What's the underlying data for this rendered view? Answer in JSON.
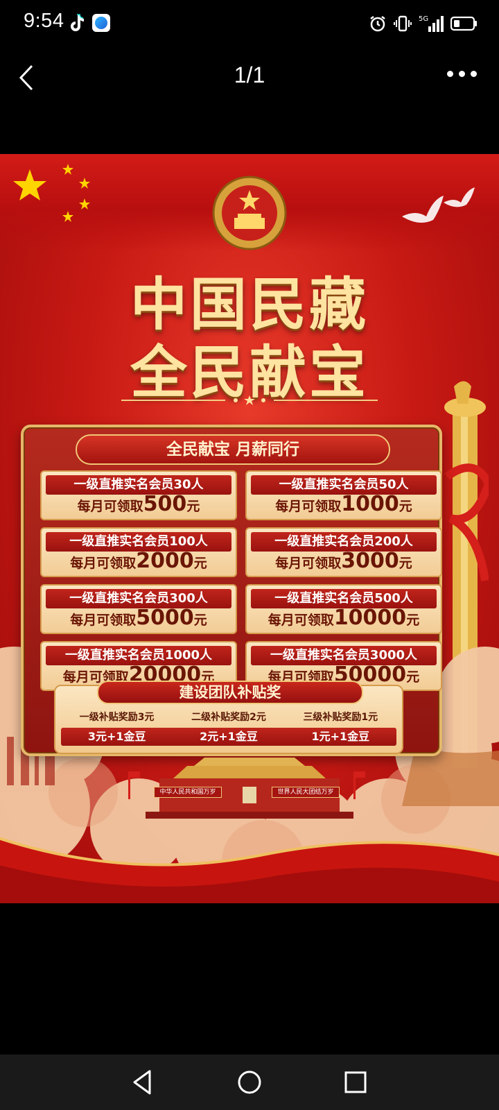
{
  "status_bar": {
    "time": "9:54",
    "icons": [
      "tiktok-icon",
      "browser-app-icon",
      "alarm-icon",
      "vibrate-icon",
      "5g-signal-icon",
      "battery-icon"
    ],
    "network": "5G"
  },
  "viewer": {
    "page_indicator": "1/1"
  },
  "poster": {
    "title_line1": "中国民藏",
    "title_line2": "全民献宝",
    "panel_header": "全民献宝  月薪同行",
    "tiers": [
      {
        "requirement": "一级直推实名会员30人",
        "prefix": "每月可领取",
        "amount": "500",
        "unit": "元"
      },
      {
        "requirement": "一级直推实名会员50人",
        "prefix": "每月可领取",
        "amount": "1000",
        "unit": "元"
      },
      {
        "requirement": "一级直推实名会员100人",
        "prefix": "每月可领取",
        "amount": "2000",
        "unit": "元"
      },
      {
        "requirement": "一级直推实名会员200人",
        "prefix": "每月可领取",
        "amount": "3000",
        "unit": "元"
      },
      {
        "requirement": "一级直推实名会员300人",
        "prefix": "每月可领取",
        "amount": "5000",
        "unit": "元"
      },
      {
        "requirement": "一级直推实名会员500人",
        "prefix": "每月可领取",
        "amount": "10000",
        "unit": "元"
      },
      {
        "requirement": "一级直推实名会员1000人",
        "prefix": "每月可领取",
        "amount": "20000",
        "unit": "元"
      },
      {
        "requirement": "一级直推实名会员3000人",
        "prefix": "每月可领取",
        "amount": "50000",
        "unit": "元"
      }
    ],
    "team_header": "建设团队补贴奖",
    "team_levels": [
      "一级补贴奖励3元",
      "二级补贴奖励2元",
      "三级补贴奖励1元"
    ],
    "team_rewards": [
      "3元+1金豆",
      "2元+1金豆",
      "1元+1金豆"
    ],
    "slogan_left": "中华人民共和国万岁",
    "slogan_right": "世界人民大团结万岁",
    "colors": {
      "red": "#c91a14",
      "gold": "#ffe3a0",
      "cream": "#fbe6c2"
    }
  }
}
